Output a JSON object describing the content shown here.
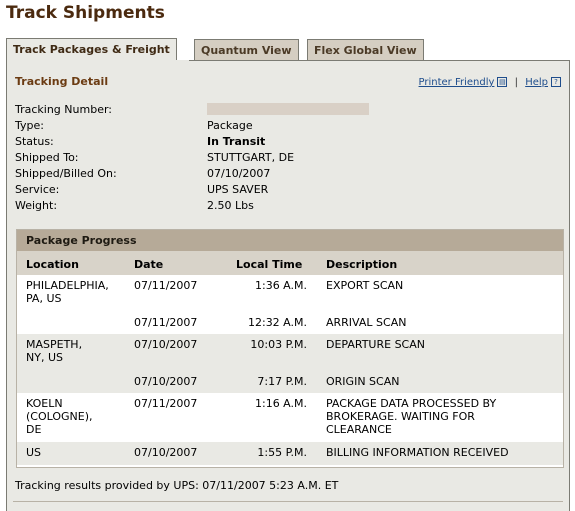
{
  "page": {
    "title": "Track Shipments"
  },
  "tabs": [
    {
      "label": "Track Packages & Freight",
      "active": true
    },
    {
      "label": "Quantum View",
      "active": false
    },
    {
      "label": "Flex Global View",
      "active": false
    }
  ],
  "detail": {
    "title": "Tracking Detail",
    "printer_friendly": "Printer Friendly",
    "separator": "|",
    "help": "Help",
    "help_icon": "?",
    "rows": [
      {
        "label": "Tracking Number:",
        "value": ""
      },
      {
        "label": "Type:",
        "value": "Package"
      },
      {
        "label": "Status:",
        "value": "In Transit"
      },
      {
        "label": "Shipped To:",
        "value": "STUTTGART, DE"
      },
      {
        "label": "Shipped/Billed On:",
        "value": "07/10/2007"
      },
      {
        "label": "Service:",
        "value": "UPS SAVER"
      },
      {
        "label": "Weight:",
        "value": "2.50 Lbs"
      }
    ]
  },
  "progress": {
    "title": "Package Progress",
    "columns": {
      "location": "Location",
      "date": "Date",
      "local_time": "Local Time",
      "description": "Description"
    },
    "rows": [
      {
        "location": "PHILADELPHIA,\nPA,  US",
        "date": "07/11/2007",
        "time": "1:36 A.M.",
        "description": "EXPORT SCAN"
      },
      {
        "location": "",
        "date": "07/11/2007",
        "time": "12:32 A.M.",
        "description": "ARRIVAL SCAN"
      },
      {
        "location": "MASPETH,\nNY,  US",
        "date": "07/10/2007",
        "time": "10:03 P.M.",
        "description": "DEPARTURE SCAN"
      },
      {
        "location": "",
        "date": "07/10/2007",
        "time": "7:17 P.M.",
        "description": "ORIGIN SCAN"
      },
      {
        "location": "KOELN\n(COLOGNE),\nDE",
        "date": "07/11/2007",
        "time": "1:16 A.M.",
        "description": "PACKAGE DATA PROCESSED BY\nBROKERAGE. WAITING FOR\nCLEARANCE"
      },
      {
        "location": "US",
        "date": "07/10/2007",
        "time": "1:55 P.M.",
        "description": "BILLING INFORMATION RECEIVED"
      }
    ]
  },
  "footer": {
    "text": "Tracking results provided by UPS:  07/11/2007 5:23 A.M.  ET"
  },
  "colors": {
    "title": "#4b2a0f",
    "section_title": "#6b3b12",
    "link": "#1e4d8c",
    "panel_bg": "#e9e9e4",
    "progress_header": "#b6aa98",
    "column_header": "#d8d3c9"
  }
}
